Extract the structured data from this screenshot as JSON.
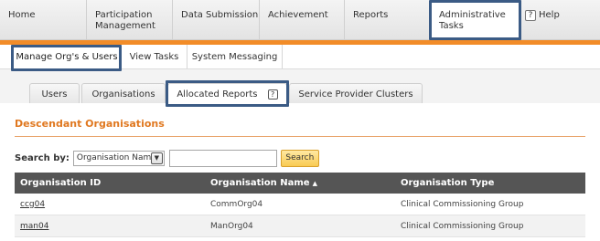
{
  "topnav": {
    "items": [
      {
        "label": "Home"
      },
      {
        "label": "Participation Management"
      },
      {
        "label": "Data Submission"
      },
      {
        "label": "Achievement"
      },
      {
        "label": "Reports"
      },
      {
        "label": "Administrative Tasks"
      }
    ],
    "help_icon": "?",
    "help_label": "Help"
  },
  "subnav": {
    "items": [
      {
        "label": "Manage Org's & Users"
      },
      {
        "label": "View Tasks"
      },
      {
        "label": "System Messaging"
      }
    ]
  },
  "tabs": {
    "items": [
      {
        "label": "Users"
      },
      {
        "label": "Organisations"
      },
      {
        "label": "Allocated Reports"
      },
      {
        "label": "Service Provider Clusters"
      }
    ],
    "help_icon": "?"
  },
  "section": {
    "title": "Descendant Organisations"
  },
  "search": {
    "label": "Search by:",
    "select_value": "Organisation Name",
    "input_value": "",
    "button_label": "Search"
  },
  "table": {
    "columns": [
      "Organisation ID",
      "Organisation Name",
      "Organisation Type"
    ],
    "sort_icon": "▲",
    "rows": [
      {
        "id": "ccg04",
        "name": "CommOrg04",
        "type": "Clinical Commissioning Group"
      },
      {
        "id": "man04",
        "name": "ManOrg04",
        "type": "Clinical Commissioning Group"
      }
    ]
  },
  "colors": {
    "accent": "#f28c28",
    "title_orange": "#e07820",
    "header_dark": "#555555",
    "highlight_box": "#3b5b85",
    "search_button": "#f9cb53"
  }
}
